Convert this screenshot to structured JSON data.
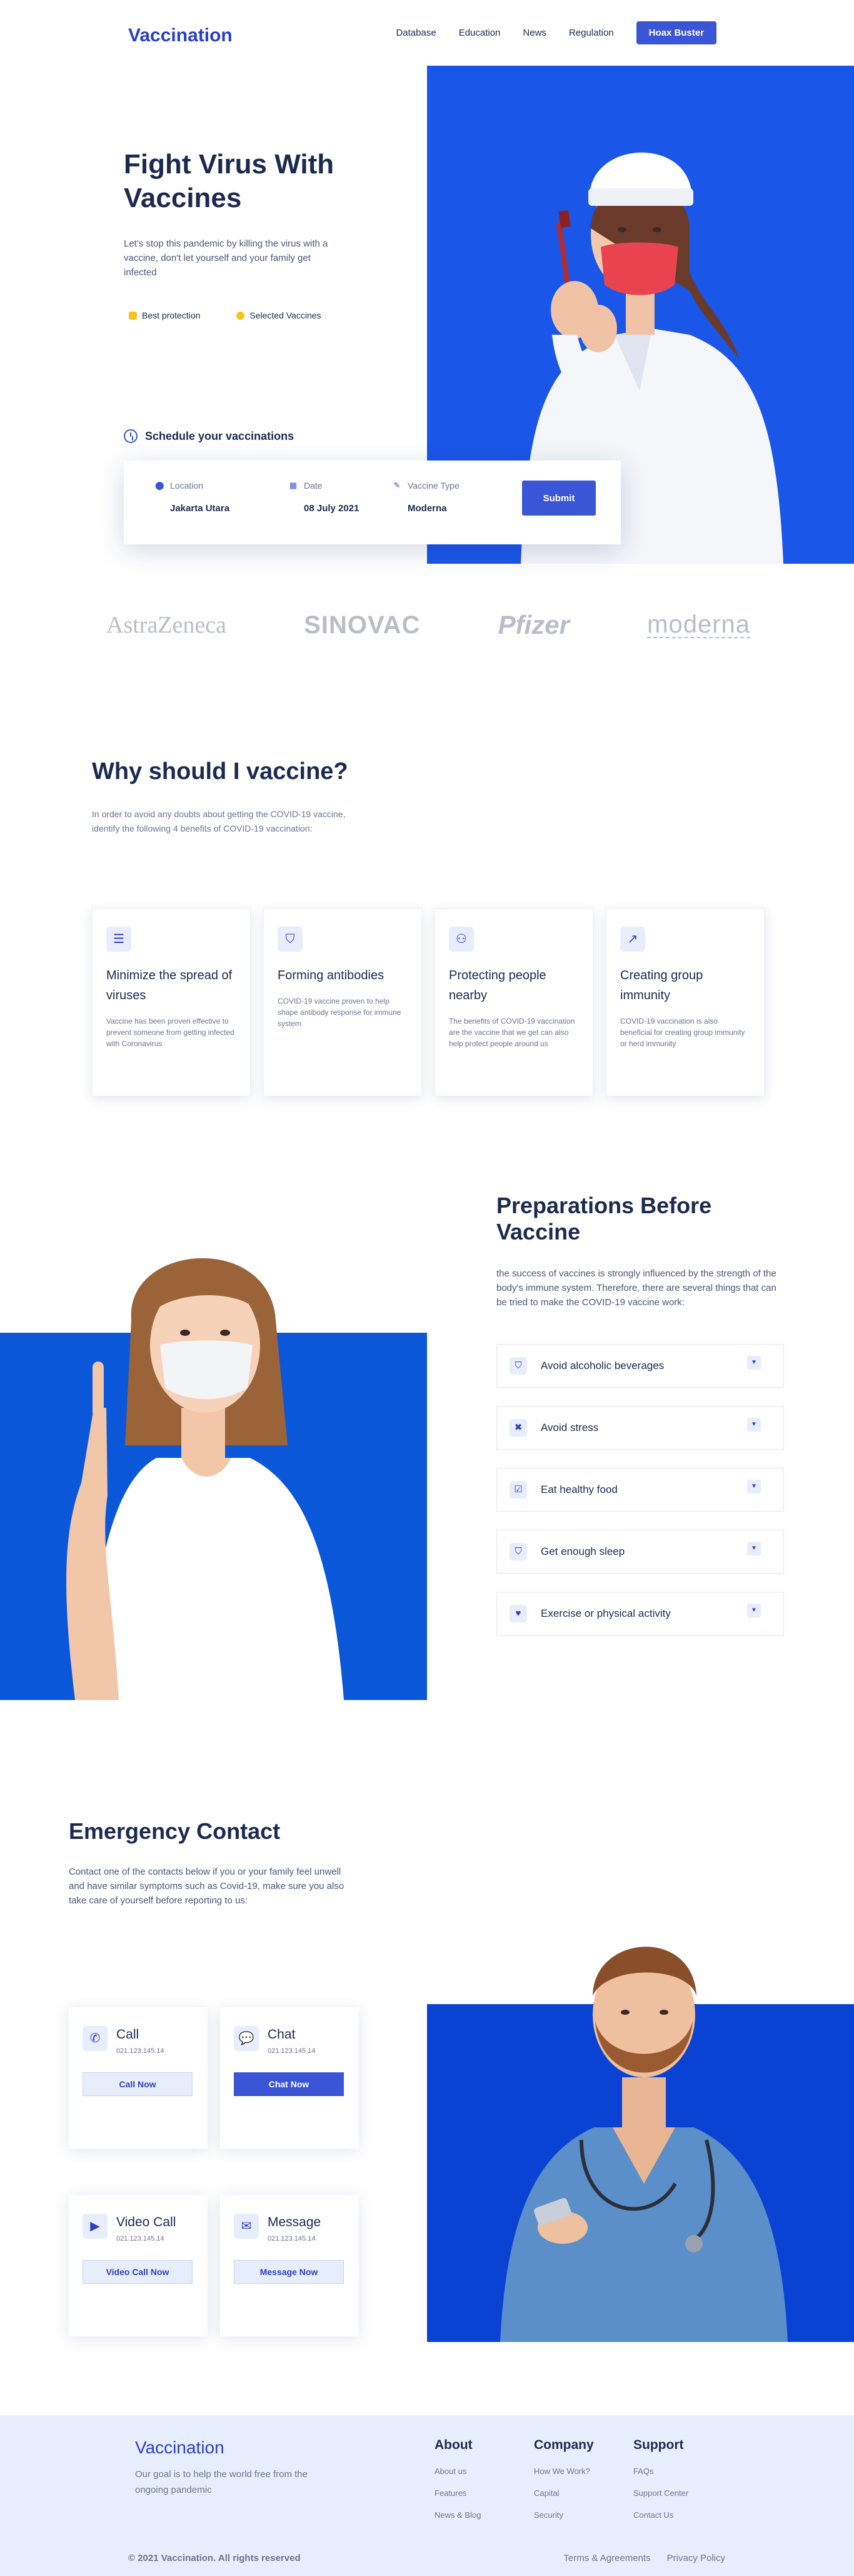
{
  "nav": {
    "logo": "Vaccination",
    "links": [
      "Database",
      "Education",
      "News",
      "Regulation"
    ],
    "cta": "Hoax Buster"
  },
  "hero": {
    "title": "Fight Virus With Vaccines",
    "description": "Let's stop this pandemic by killing the virus with a vaccine, don't let yourself and your family get infected",
    "badges": [
      "Best protection",
      "Selected Vaccines"
    ],
    "schedule_heading": "Schedule your vaccinations",
    "fields": [
      {
        "label": "Location",
        "value": "Jakarta Utara",
        "icon": "pin-icon"
      },
      {
        "label": "Date",
        "value": "08 July 2021",
        "icon": "calendar-icon"
      },
      {
        "label": "Vaccine Type",
        "value": "Moderna",
        "icon": "edit-icon"
      }
    ],
    "submit": "Submit",
    "blue": "#1a56e8"
  },
  "brands": [
    "AstraZeneca",
    "SINOVAC",
    "Pfizer",
    "moderna"
  ],
  "why": {
    "title": "Why should I vaccine?",
    "description": "In order to avoid any doubts about getting the COVID-19 vaccine, identify the following 4 benefits of COVID-19 vaccination:",
    "cards": [
      {
        "icon": "list-icon",
        "title": "Minimize the spread of viruses",
        "desc": "Vaccine has been proven effective to prevent someone from getting infected with Coronavirus"
      },
      {
        "icon": "shield-icon",
        "title": "Forming antibodies",
        "desc": "COVID-19 vaccine proven to help shape antibody response for immune system"
      },
      {
        "icon": "people-icon",
        "title": "Protecting people nearby",
        "desc": "The benefits of COVID-19 vaccination are the vaccine that we get can also help protect people around us"
      },
      {
        "icon": "chart-icon",
        "title": "Creating group immunity",
        "desc": "COVID-19 vaccination is also beneficial for creating group immunity or herd immunity"
      }
    ]
  },
  "prep": {
    "title": "Preparations Before Vaccine",
    "description": "the success of vaccines is strongly influenced by the strength of the body's immune system. Therefore, there are several things that can be tried to make the COVID-19 vaccine work:",
    "items": [
      {
        "icon": "shield-icon",
        "label": "Avoid alcoholic beverages"
      },
      {
        "icon": "x-icon",
        "label": "Avoid stress"
      },
      {
        "icon": "check-icon",
        "label": "Eat healthy food"
      },
      {
        "icon": "shield-icon",
        "label": "Get enough sleep"
      },
      {
        "icon": "heart-icon",
        "label": "Exercise or physical activity"
      }
    ]
  },
  "emergency": {
    "title": "Emergency Contact",
    "description": "Contact one of the contacts below if you or your family feel unwell and have similar symptoms such as Covid-19, make sure you also take care of yourself before reporting to us:",
    "contacts": [
      {
        "icon": "phone-icon",
        "name": "Call",
        "number": "021.123.145.14",
        "button": "Call Now"
      },
      {
        "icon": "chat-icon",
        "name": "Chat",
        "number": "021.123.145.14",
        "button": "Chat Now"
      },
      {
        "icon": "video-icon",
        "name": "Video Call",
        "number": "021.123.145.14",
        "button": "Video Call Now"
      },
      {
        "icon": "mail-icon",
        "name": "Message",
        "number": "021.123.145.14",
        "button": "Message Now"
      }
    ]
  },
  "footer": {
    "logo": "Vaccination",
    "tagline": "Our goal is to help the world free from the ongoing pandemic",
    "columns": [
      {
        "title": "About",
        "links": [
          "About us",
          "Features",
          "News & Blog"
        ]
      },
      {
        "title": "Company",
        "links": [
          "How We Work?",
          "Capital",
          "Security"
        ]
      },
      {
        "title": "Support",
        "links": [
          "FAQs",
          "Support Center",
          "Contact Us"
        ]
      }
    ],
    "copyright": "© 2021 Vaccination. All rights reserved",
    "legal": [
      "Terms & Agreements",
      "Privacy Policy"
    ]
  }
}
